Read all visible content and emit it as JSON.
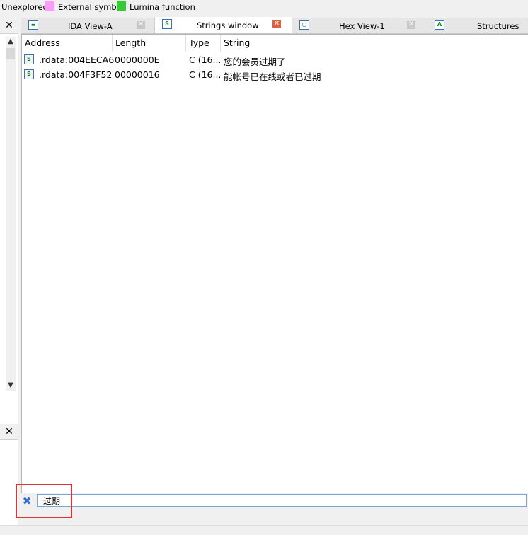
{
  "legend": {
    "items": [
      {
        "label": "Unexplored",
        "color": ""
      },
      {
        "label": "External symbol",
        "color": "#ff9aff"
      },
      {
        "label": "Lumina function",
        "color": "#33cc33"
      }
    ]
  },
  "left_panel": {
    "close_glyph": "✕",
    "close_glyph_2": "✕"
  },
  "tabs": [
    {
      "label": "IDA View-A",
      "icon": "listing-icon",
      "active": false
    },
    {
      "label": "Strings window",
      "icon": "strings-icon",
      "active": true
    },
    {
      "label": "Hex View-1",
      "icon": "hex-icon",
      "active": false
    },
    {
      "label": "Structures",
      "icon": "structures-icon",
      "active": false
    }
  ],
  "table": {
    "columns": [
      "Address",
      "Length",
      "Type",
      "String"
    ],
    "rows": [
      {
        "address": ".rdata:004EECA6",
        "length": "0000000E",
        "type": "C (16...",
        "string": "您的会员过期了"
      },
      {
        "address": ".rdata:004F3F52",
        "length": "00000016",
        "type": "C (16...",
        "string": "能帐号已在线或者已过期"
      }
    ]
  },
  "filter": {
    "value": "过期",
    "clear_icon": "clear-filter-icon"
  },
  "colors": {
    "accent": "#3a6fb0",
    "highlight_box": "#e03030",
    "active_close": "#e06040"
  }
}
